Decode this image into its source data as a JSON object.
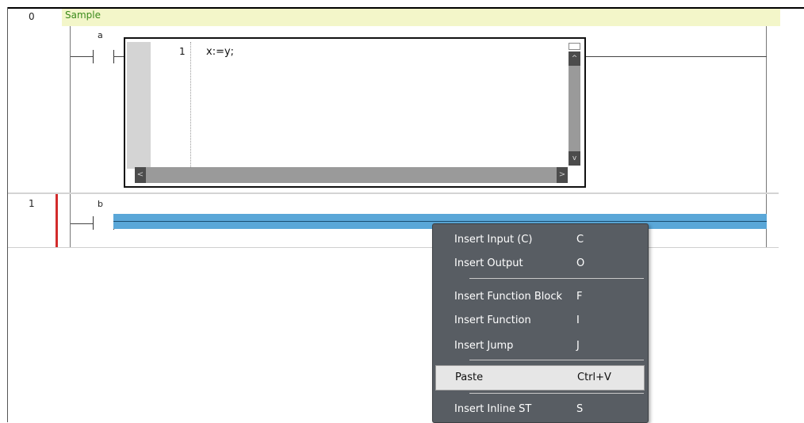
{
  "rungs": [
    {
      "number": "0",
      "comment": "Sample",
      "contact_label": "a"
    },
    {
      "number": "1",
      "contact_label": "b"
    }
  ],
  "inline_st": {
    "line_number": "1",
    "code": "x:=y;",
    "scroll_up": "^",
    "scroll_down": "v",
    "scroll_left": "<",
    "scroll_right": ">"
  },
  "context_menu": {
    "items": [
      {
        "label": "Insert Input (C)",
        "shortcut": "C"
      },
      {
        "label": "Insert Output",
        "shortcut": "O"
      },
      {
        "label": "Insert Function Block",
        "shortcut": "F"
      },
      {
        "label": "Insert Function",
        "shortcut": "I"
      },
      {
        "label": "Insert Jump",
        "shortcut": "J"
      },
      {
        "label": "Paste",
        "shortcut": "Ctrl+V",
        "highlighted": true
      },
      {
        "label": "Insert Inline ST",
        "shortcut": "S"
      }
    ]
  },
  "colors": {
    "comment_bg": "#f3f6c9",
    "comment_text": "#3a8a1a",
    "selection": "#5aa7d8",
    "menu_bg": "#585d63",
    "error_mark": "#d22b2b"
  }
}
